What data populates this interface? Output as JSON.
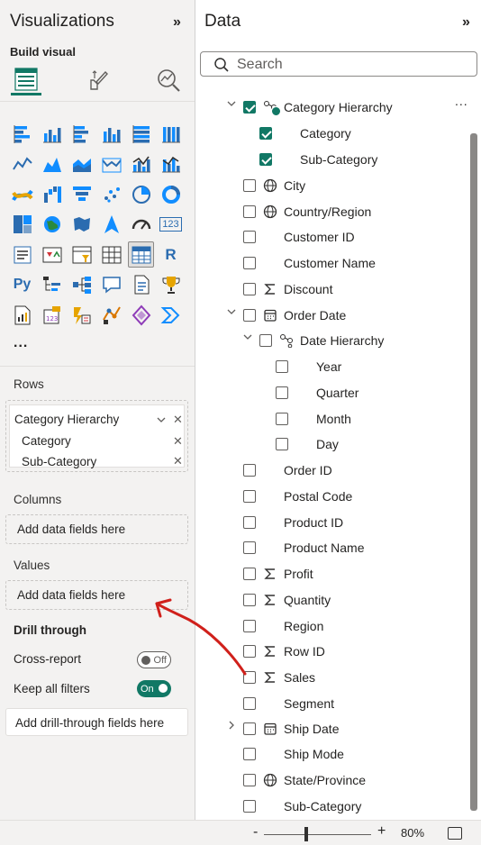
{
  "viz": {
    "title": "Visualizations",
    "collapse": "»",
    "build_label": "Build visual",
    "more": "...",
    "gallery": [
      "stacked-bar-icon",
      "stacked-column-icon",
      "clustered-bar-icon",
      "clustered-column-icon",
      "100-bar-icon",
      "100-column-icon",
      "line-icon",
      "area-icon",
      "stacked-area-icon",
      "ribbon-line-icon",
      "line-column-icon",
      "line-clustered-icon",
      "ribbon-icon",
      "waterfall-icon",
      "funnel-icon",
      "scatter-icon",
      "pie-icon",
      "donut-icon",
      "treemap-icon",
      "map-icon",
      "filled-map-icon",
      "azure-map-icon",
      "gauge-icon",
      "card-icon",
      "multirow-card-icon",
      "kpi-icon",
      "slicer-icon",
      "table-icon",
      "matrix-icon",
      "r-visual-icon",
      "python-visual-icon",
      "key-influencers-icon",
      "decomposition-tree-icon",
      "qa-icon",
      "smart-narrative-icon",
      "metrics-icon",
      "paginated-report-icon",
      "power-apps-icon",
      "power-automate-icon",
      "arcgis-icon",
      "custom-visual-icon",
      "powerautomate2-icon"
    ],
    "r_text": "R",
    "py_text": "Py",
    "card_text": "123",
    "rows_label": "Rows",
    "rows_fields": [
      {
        "label": "Category Hierarchy"
      },
      {
        "label": "Category"
      },
      {
        "label": "Sub-Category"
      }
    ],
    "columns_label": "Columns",
    "columns_placeholder": "Add data fields here",
    "values_label": "Values",
    "values_placeholder": "Add data fields here",
    "drill_title": "Drill through",
    "cross_report_label": "Cross-report",
    "cross_report_state": "Off",
    "keep_filters_label": "Keep all filters",
    "keep_filters_state": "On",
    "drill_placeholder": "Add drill-through fields here"
  },
  "data": {
    "title": "Data",
    "collapse": "»",
    "search_placeholder": "Search",
    "more_options": "...",
    "items": [
      {
        "label": "Category Hierarchy",
        "checked": true,
        "icon": "hierarchy-icon",
        "expander": "open"
      },
      {
        "label": "Category",
        "checked": true
      },
      {
        "label": "Sub-Category",
        "checked": true
      },
      {
        "label": "City",
        "checked": false,
        "icon": "globe-icon"
      },
      {
        "label": "Country/Region",
        "checked": false,
        "icon": "globe-icon"
      },
      {
        "label": "Customer ID",
        "checked": false
      },
      {
        "label": "Customer Name",
        "checked": false
      },
      {
        "label": "Discount",
        "checked": false,
        "icon": "sigma-icon"
      },
      {
        "label": "Order Date",
        "checked": false,
        "icon": "calendar-icon",
        "expander": "open"
      },
      {
        "label": "Date Hierarchy",
        "checked": false,
        "icon": "hierarchy-icon",
        "expander": "open"
      },
      {
        "label": "Year",
        "checked": false
      },
      {
        "label": "Quarter",
        "checked": false
      },
      {
        "label": "Month",
        "checked": false
      },
      {
        "label": "Day",
        "checked": false
      },
      {
        "label": "Order ID",
        "checked": false
      },
      {
        "label": "Postal Code",
        "checked": false
      },
      {
        "label": "Product ID",
        "checked": false
      },
      {
        "label": "Product Name",
        "checked": false
      },
      {
        "label": "Profit",
        "checked": false,
        "icon": "sigma-icon"
      },
      {
        "label": "Quantity",
        "checked": false,
        "icon": "sigma-icon"
      },
      {
        "label": "Region",
        "checked": false
      },
      {
        "label": "Row ID",
        "checked": false,
        "icon": "sigma-icon"
      },
      {
        "label": "Sales",
        "checked": false,
        "icon": "sigma-icon"
      },
      {
        "label": "Segment",
        "checked": false
      },
      {
        "label": "Ship Date",
        "checked": false,
        "icon": "calendar-icon",
        "expander": "closed"
      },
      {
        "label": "Ship Mode",
        "checked": false
      },
      {
        "label": "State/Province",
        "checked": false,
        "icon": "globe-icon"
      },
      {
        "label": "Sub-Category",
        "checked": false
      }
    ]
  },
  "status": {
    "zoom_minus": "-",
    "zoom_plus": "+",
    "zoom_level": "80%"
  },
  "colors": {
    "accent": "#117865",
    "annotation": "#d0201b"
  }
}
